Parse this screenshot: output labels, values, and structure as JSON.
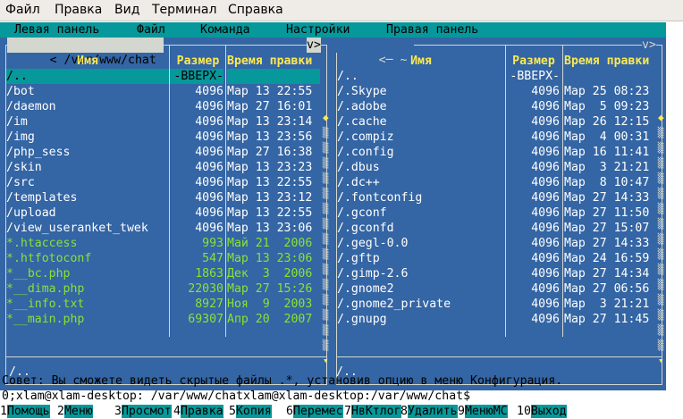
{
  "menubar": {
    "items": [
      "Файл",
      "Правка",
      "Вид",
      "Терминал",
      "Справка"
    ]
  },
  "mc_menu": {
    "items": [
      "Левая панель",
      "Файл",
      "Команда",
      "Настройки",
      "Правая панель"
    ]
  },
  "left_panel": {
    "path": "/var/www/chat",
    "path_left": "<",
    "path_right": "v>",
    "headers": {
      "name": "Имя",
      "size": "Размер",
      "mtime": "Время правки"
    },
    "rows": [
      {
        "name": "/..",
        "size": "-ВВЕРХ-",
        "mtime": "",
        "type": "selected"
      },
      {
        "name": "/bot",
        "size": "4096",
        "mtime": "Мар 13 22:55",
        "type": "dir"
      },
      {
        "name": "/daemon",
        "size": "4096",
        "mtime": "Мар 27 16:01",
        "type": "dir"
      },
      {
        "name": "/im",
        "size": "4096",
        "mtime": "Мар 13 23:14",
        "type": "dir"
      },
      {
        "name": "/img",
        "size": "4096",
        "mtime": "Мар 13 23:56",
        "type": "dir"
      },
      {
        "name": "/php_sess",
        "size": "4096",
        "mtime": "Мар 27 16:38",
        "type": "dir"
      },
      {
        "name": "/skin",
        "size": "4096",
        "mtime": "Мар 13 23:23",
        "type": "dir"
      },
      {
        "name": "/src",
        "size": "4096",
        "mtime": "Мар 13 22:55",
        "type": "dir"
      },
      {
        "name": "/templates",
        "size": "4096",
        "mtime": "Мар 13 23:12",
        "type": "dir"
      },
      {
        "name": "/upload",
        "size": "4096",
        "mtime": "Мар 13 22:55",
        "type": "dir"
      },
      {
        "name": "/view_useranket_twek",
        "size": "4096",
        "mtime": "Мар 13 23:06",
        "type": "dir"
      },
      {
        "name": "*.htaccess",
        "size": "993",
        "mtime": "Май 21  2006",
        "type": "exec"
      },
      {
        "name": "*.htfotoconf",
        "size": "547",
        "mtime": "Мар 13 23:06",
        "type": "exec"
      },
      {
        "name": "*__bc.php",
        "size": "1863",
        "mtime": "Дек  3  2006",
        "type": "exec"
      },
      {
        "name": "*__dima.php",
        "size": "22030",
        "mtime": "Мар 27 15:26",
        "type": "exec"
      },
      {
        "name": "*__info.txt",
        "size": "8927",
        "mtime": "Ноя  9  2003",
        "type": "exec"
      },
      {
        "name": "*__main.php",
        "size": "69307",
        "mtime": "Апр 20  2007",
        "type": "exec"
      }
    ],
    "mini_status": "/.."
  },
  "right_panel": {
    "path": "~",
    "path_left": "<─",
    "path_right": "v>",
    "headers": {
      "name": "Имя",
      "size": "Размер",
      "mtime": "Время правки"
    },
    "rows": [
      {
        "name": "/..",
        "size": "-ВВЕРХ-",
        "mtime": "",
        "type": "dir"
      },
      {
        "name": "/.Skype",
        "size": "4096",
        "mtime": "Мар 25 08:23",
        "type": "dir"
      },
      {
        "name": "/.adobe",
        "size": "4096",
        "mtime": "Мар  5 09:23",
        "type": "dir"
      },
      {
        "name": "/.cache",
        "size": "4096",
        "mtime": "Мар 26 12:15",
        "type": "dir"
      },
      {
        "name": "/.compiz",
        "size": "4096",
        "mtime": "Мар  4 00:31",
        "type": "dir"
      },
      {
        "name": "/.config",
        "size": "4096",
        "mtime": "Мар 16 11:41",
        "type": "dir"
      },
      {
        "name": "/.dbus",
        "size": "4096",
        "mtime": "Мар  3 21:21",
        "type": "dir"
      },
      {
        "name": "/.dc++",
        "size": "4096",
        "mtime": "Мар  8 10:47",
        "type": "dir"
      },
      {
        "name": "/.fontconfig",
        "size": "4096",
        "mtime": "Мар 27 14:33",
        "type": "dir"
      },
      {
        "name": "/.gconf",
        "size": "4096",
        "mtime": "Мар 27 11:50",
        "type": "dir"
      },
      {
        "name": "/.gconfd",
        "size": "4096",
        "mtime": "Мар 27 15:07",
        "type": "dir"
      },
      {
        "name": "/.gegl-0.0",
        "size": "4096",
        "mtime": "Мар 27 14:33",
        "type": "dir"
      },
      {
        "name": "/.gftp",
        "size": "4096",
        "mtime": "Мар 24 16:59",
        "type": "dir"
      },
      {
        "name": "/.gimp-2.6",
        "size": "4096",
        "mtime": "Мар 27 14:34",
        "type": "dir"
      },
      {
        "name": "/.gnome2",
        "size": "4096",
        "mtime": "Мар 27 06:56",
        "type": "dir"
      },
      {
        "name": "/.gnome2_private",
        "size": "4096",
        "mtime": "Мар  3 21:21",
        "type": "dir"
      },
      {
        "name": "/.gnupg",
        "size": "4096",
        "mtime": "Мар 27 11:45",
        "type": "dir"
      }
    ],
    "mini_status": "/.."
  },
  "hint": "Совет: Вы сможете видеть скрытые файлы .*, установив опцию в меню Конфигурация.",
  "prompt": "0;xlam@xlam-desktop: /var/www/chatxlam@xlam-desktop:/var/www/chat$",
  "fkeys": [
    {
      "num": "1",
      "label": "Помощь"
    },
    {
      "num": "2",
      "label": "Меню"
    },
    {
      "num": "3",
      "label": "Просмот"
    },
    {
      "num": "4",
      "label": "Правка"
    },
    {
      "num": "5",
      "label": "Копия"
    },
    {
      "num": "6",
      "label": "Перемес"
    },
    {
      "num": "7",
      "label": "НвКтлог"
    },
    {
      "num": "8",
      "label": "Удалить"
    },
    {
      "num": "9",
      "label": "МенюМС"
    },
    {
      "num": "10",
      "label": "Выход"
    }
  ],
  "colors": {
    "panel_bg": "#3465a4",
    "cyan": "#06989a",
    "header_yellow": "#fce94f",
    "exec_green": "#8ae234"
  }
}
